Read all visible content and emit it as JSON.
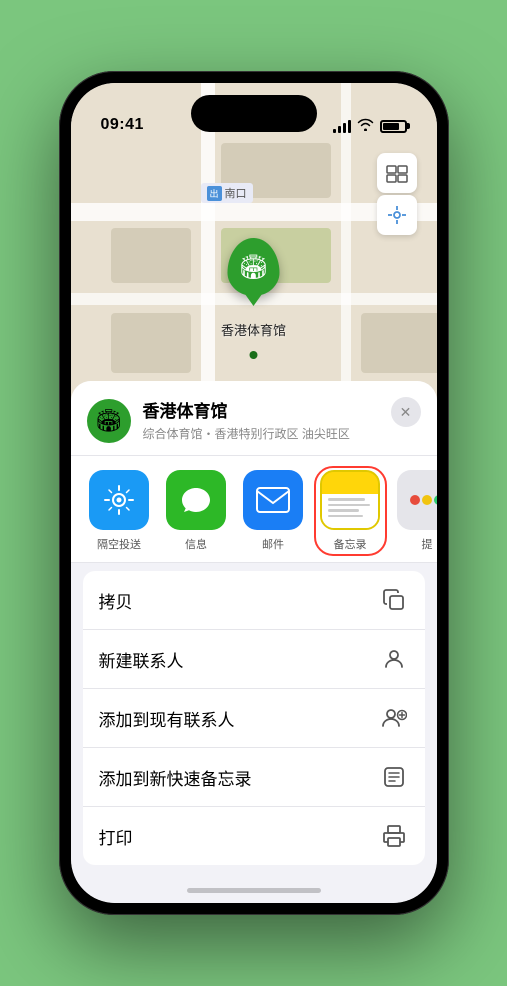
{
  "statusBar": {
    "time": "09:41",
    "locationIndicator": "▶"
  },
  "map": {
    "labelNankou": "南口",
    "labelPrefix": "出"
  },
  "venueMarker": {
    "name": "香港体育馆",
    "icon": "🏟"
  },
  "venueCard": {
    "name": "香港体育馆",
    "subtitle": "综合体育馆・香港特别行政区 油尖旺区",
    "icon": "🏟",
    "closeLabel": "✕"
  },
  "shareRow": {
    "items": [
      {
        "id": "airdrop",
        "label": "隔空投送",
        "icon": "📡",
        "class": "airdrop"
      },
      {
        "id": "messages",
        "label": "信息",
        "icon": "💬",
        "class": "messages"
      },
      {
        "id": "mail",
        "label": "邮件",
        "icon": "✉",
        "class": "mail"
      },
      {
        "id": "notes",
        "label": "备忘录",
        "icon": "notes",
        "class": "notes"
      },
      {
        "id": "more",
        "label": "提",
        "icon": "more",
        "class": "more"
      }
    ]
  },
  "actionList": [
    {
      "id": "copy",
      "label": "拷贝",
      "icon": "copy"
    },
    {
      "id": "new-contact",
      "label": "新建联系人",
      "icon": "person"
    },
    {
      "id": "add-contact",
      "label": "添加到现有联系人",
      "icon": "person-add"
    },
    {
      "id": "add-note",
      "label": "添加到新快速备忘录",
      "icon": "note"
    },
    {
      "id": "print",
      "label": "打印",
      "icon": "print"
    }
  ]
}
